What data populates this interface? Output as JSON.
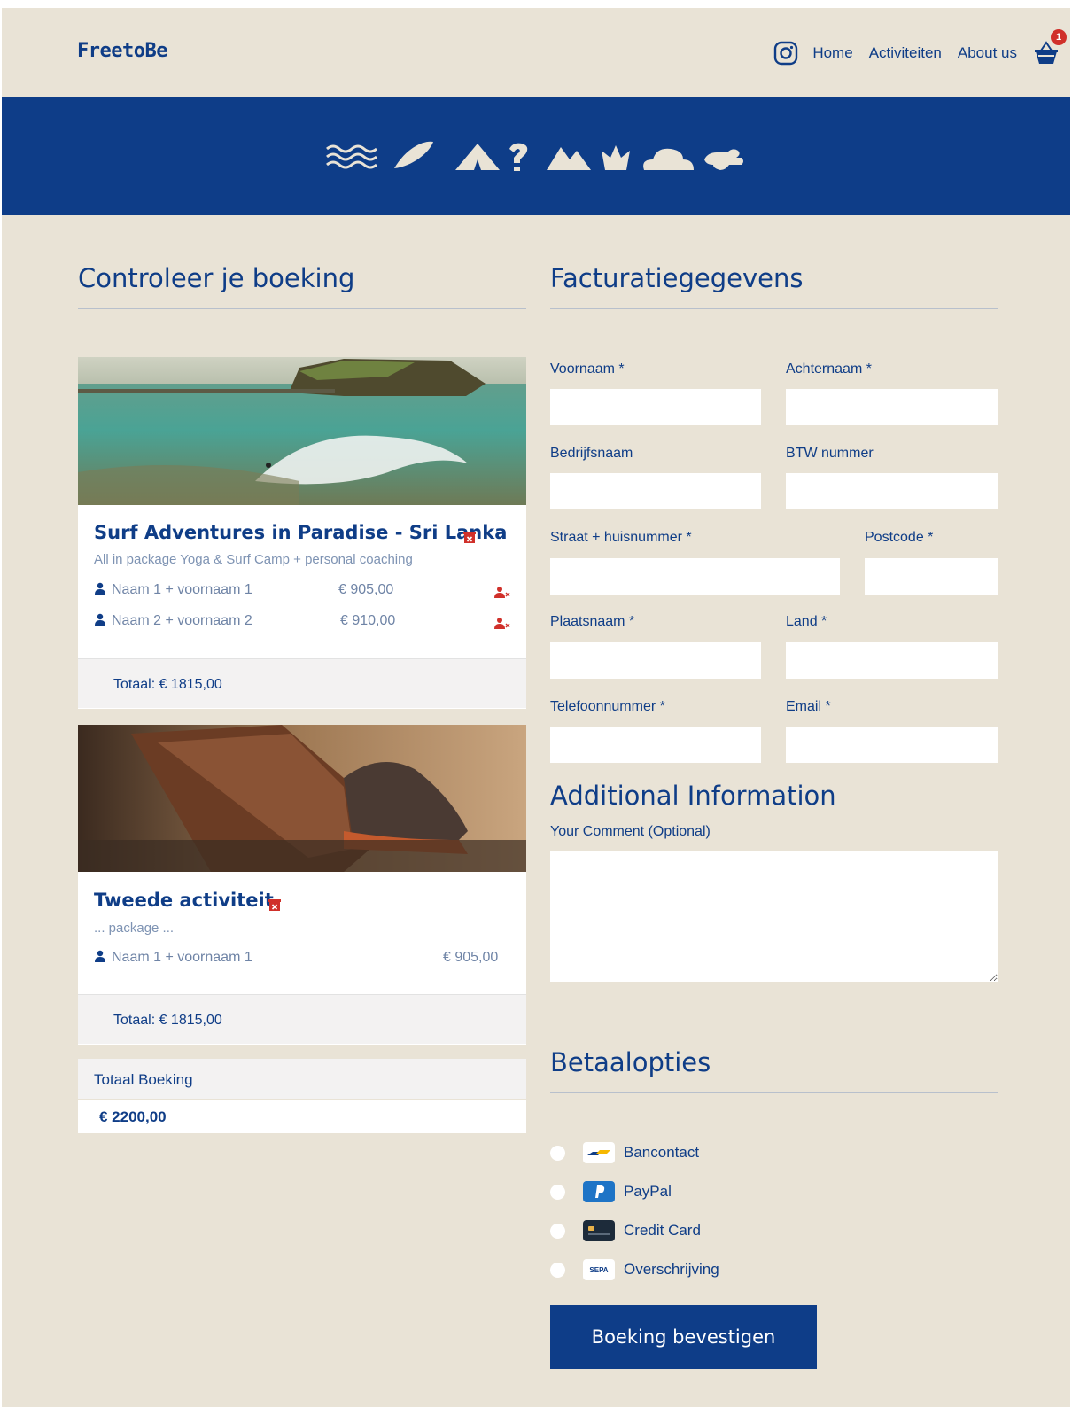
{
  "header": {
    "logo": "FreetoBe",
    "nav": [
      "Home",
      "Activiteiten",
      "About us"
    ],
    "cart_count": "1"
  },
  "booking": {
    "title": "Controleer je boeking",
    "activities": [
      {
        "title": "Surf Adventures in Paradise - Sri Lanka",
        "subtitle": "All in package Yoga & Surf Camp + personal coaching",
        "participants": [
          {
            "name": "Naam 1 + voornaam 1",
            "price": "€ 905,00"
          },
          {
            "name": "Naam 2 + voornaam 2",
            "price": "€ 910,00"
          }
        ],
        "total": "Totaal: € 1815,00"
      },
      {
        "title": "Tweede activiteit",
        "subtitle": "... package ...",
        "participants": [
          {
            "name": "Naam 1 + voornaam 1",
            "price": "€ 905,00"
          }
        ],
        "total": "Totaal: € 1815,00"
      }
    ],
    "grand_total_label": "Totaal Boeking",
    "grand_total_value": "€ 2200,00"
  },
  "billing": {
    "title": "Facturatiegegevens",
    "fields": {
      "voornaam": "Voornaam *",
      "achternaam": "Achternaam *",
      "bedrijfsnaam": "Bedrijfsnaam",
      "btw": "BTW nummer",
      "straat": "Straat + huisnummer *",
      "postcode": "Postcode *",
      "plaats": "Plaatsnaam *",
      "land": "Land *",
      "telefoon": "Telefoonnummer *",
      "email": "Email *"
    }
  },
  "additional": {
    "title": "Additional Information",
    "comment_label": "Your Comment (Optional)"
  },
  "payment": {
    "title": "Betaalopties",
    "options": [
      "Bancontact",
      "PayPal",
      "Credit Card",
      "Overschrijving"
    ],
    "sepa_text": "SEPA",
    "confirm_label": "Boeking bevestigen"
  },
  "colors": {
    "brand_blue": "#0e3d88",
    "background": "#e9e3d6",
    "danger": "#d0302a"
  }
}
